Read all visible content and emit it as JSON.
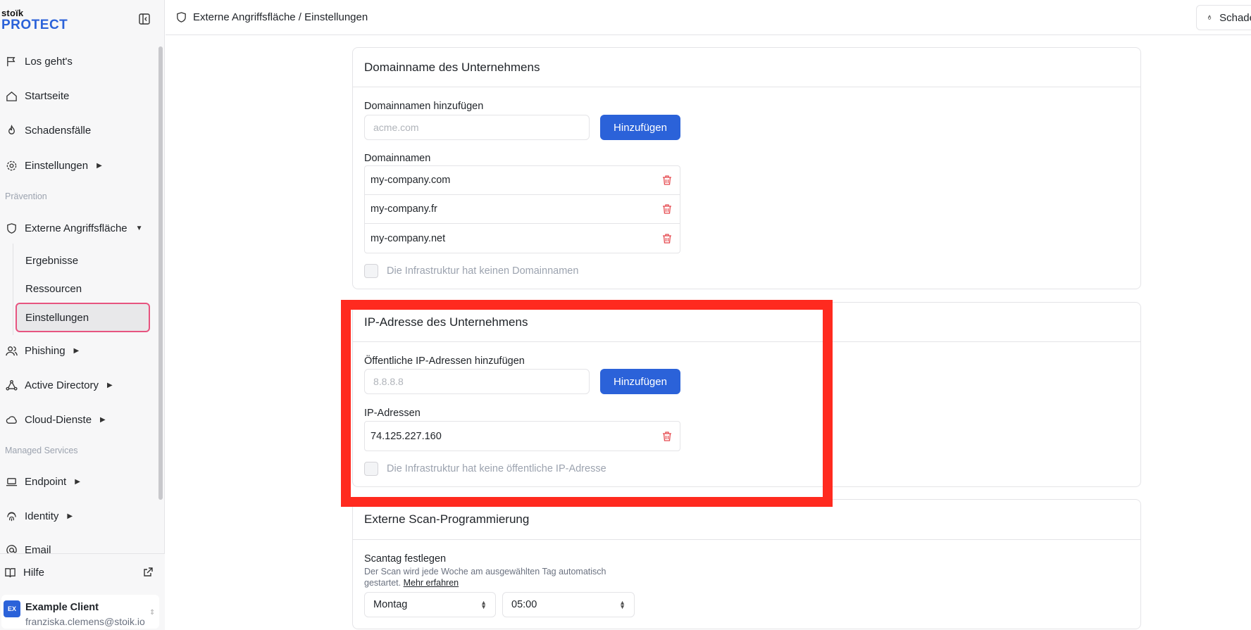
{
  "sidebar": {
    "logo_top": "stoïk",
    "logo_bottom": "PROTECT",
    "nav": {
      "los_gehts": "Los geht's",
      "startseite": "Startseite",
      "schadensfaelle": "Schadensfälle",
      "einstellungen": "Einstellungen",
      "section_praevention": "Prävention",
      "externe": "Externe Angriffsfläche",
      "ergebnisse": "Ergebnisse",
      "ressourcen": "Ressourcen",
      "einstellungen_sub": "Einstellungen",
      "phishing": "Phishing",
      "active_directory": "Active Directory",
      "cloud": "Cloud-Dienste",
      "section_managed": "Managed Services",
      "endpoint": "Endpoint",
      "identity": "Identity",
      "email": "Email"
    },
    "help": "Hilfe",
    "account": {
      "initials": "EX",
      "name": "Example Client",
      "email": "franziska.clemens@stoik.io"
    }
  },
  "topbar": {
    "breadcrumb": "Externe Angriffsfläche / Einstellungen",
    "button": "Schadensfall"
  },
  "domain_card": {
    "title": "Domainname des Unternehmens",
    "add_label": "Domainnamen hinzufügen",
    "placeholder": "acme.com",
    "add_button": "Hinzufügen",
    "list_label": "Domainnamen",
    "items": [
      "my-company.com",
      "my-company.fr",
      "my-company.net"
    ],
    "checkbox_label": "Die Infrastruktur hat keinen Domainnamen"
  },
  "ip_card": {
    "title": "IP-Adresse des Unternehmens",
    "add_label": "Öffentliche IP-Adressen hinzufügen",
    "placeholder": "8.8.8.8",
    "add_button": "Hinzufügen",
    "list_label": "IP-Adressen",
    "items": [
      "74.125.227.160"
    ],
    "checkbox_label": "Die Infrastruktur hat keine öffentliche IP-Adresse"
  },
  "scan_card": {
    "title": "Externe Scan-Programmierung",
    "day_label": "Scantag festlegen",
    "hint": "Der Scan wird jede Woche am ausgewählten Tag automatisch gestartet.",
    "learn_more": "Mehr erfahren",
    "day_value": "Montag",
    "time_value": "05:00"
  },
  "colors": {
    "accent": "#2b62d9",
    "highlight": "#ff2a1f",
    "active_border": "#e75480",
    "danger": "#e5484d"
  }
}
